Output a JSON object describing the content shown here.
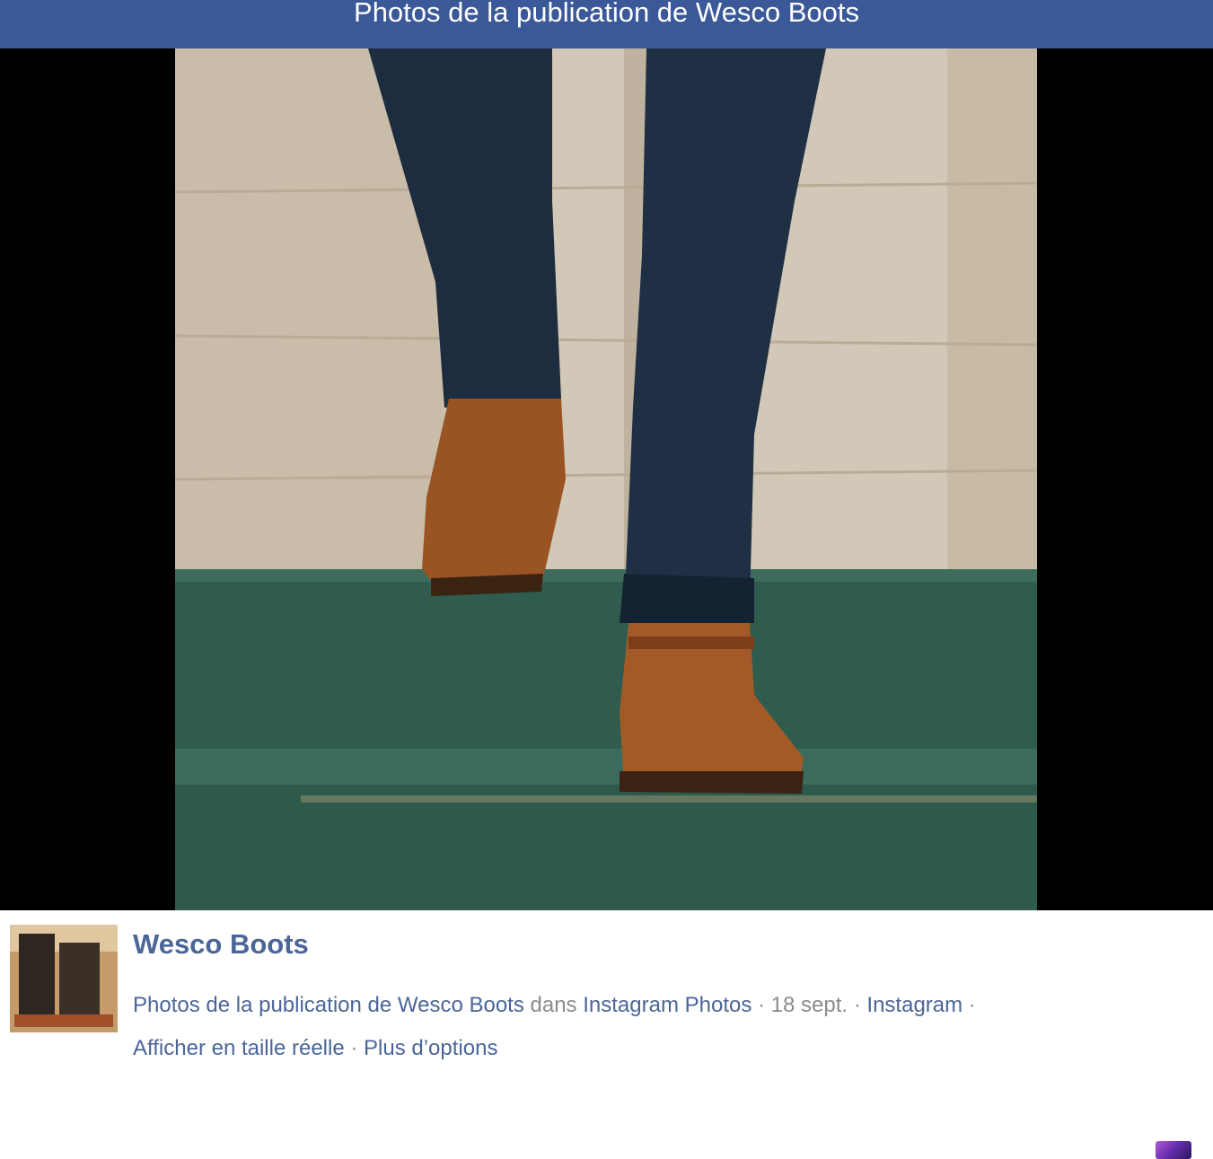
{
  "header": {
    "title": "Photos de la publication de Wesco Boots"
  },
  "photo": {
    "description_icon": "photo-boots-on-stairs"
  },
  "post": {
    "page_name": "Wesco Boots",
    "album_link": "Photos de la publication de Wesco Boots",
    "in_word": "dans",
    "album_name": "Instagram Photos",
    "sep1": " · ",
    "date": "18 sept.",
    "sep2": " · ",
    "source": "Instagram",
    "sep3": " · ",
    "full_size": "Afficher en taille réelle",
    "sep4": " · ",
    "more_options": "Plus d’options"
  },
  "colors": {
    "header_bg": "#3b5998",
    "link": "#4b6597",
    "muted": "#8b8b8b"
  }
}
